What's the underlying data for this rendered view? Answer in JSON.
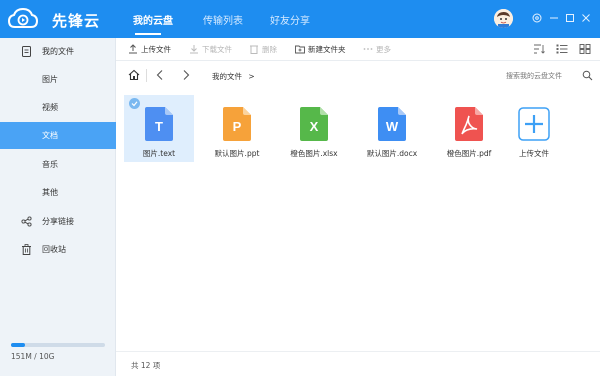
{
  "app": {
    "title": "先锋云"
  },
  "nav": {
    "tabs": [
      "我的云盘",
      "传输列表",
      "好友分享"
    ]
  },
  "sidebar": {
    "items": [
      {
        "label": "我的文件",
        "icon": "document-icon"
      },
      {
        "label": "图片"
      },
      {
        "label": "视频"
      },
      {
        "label": "文档",
        "active": true
      },
      {
        "label": "音乐"
      },
      {
        "label": "其他"
      },
      {
        "label": "分享链接",
        "icon": "share-icon"
      },
      {
        "label": "回收站",
        "icon": "trash-icon"
      }
    ],
    "storage": {
      "text": "151M / 10G",
      "used_fraction": 0.151
    }
  },
  "toolbar": {
    "upload": "上传文件",
    "download": "下载文件",
    "delete": "删除",
    "new_folder": "新建文件夹",
    "more": "更多"
  },
  "pathbar": {
    "crumb": "我的文件",
    "crumb_sep": ">",
    "search_placeholder": "搜索我的云盘文件"
  },
  "files": [
    {
      "name": "图片.text",
      "letter": "T",
      "color": "#4e8ff2",
      "selected": true
    },
    {
      "name": "默认图片.ppt",
      "letter": "P",
      "color": "#f6a23a"
    },
    {
      "name": "橙色图片.xlsx",
      "letter": "X",
      "color": "#56b84a"
    },
    {
      "name": "默认图片.docx",
      "letter": "W",
      "color": "#3e8ef3"
    },
    {
      "name": "橙色图片.pdf",
      "letter": "pdf",
      "color": "#ef5350"
    },
    {
      "name": "上传文件",
      "upload": true,
      "color": "#3da0f5"
    }
  ],
  "status": {
    "count": "共 12 项"
  },
  "colors": {
    "brand": "#1e8df0",
    "sidebar_active": "#4aa3f5",
    "sidebar_bg": "#eef3f8"
  }
}
